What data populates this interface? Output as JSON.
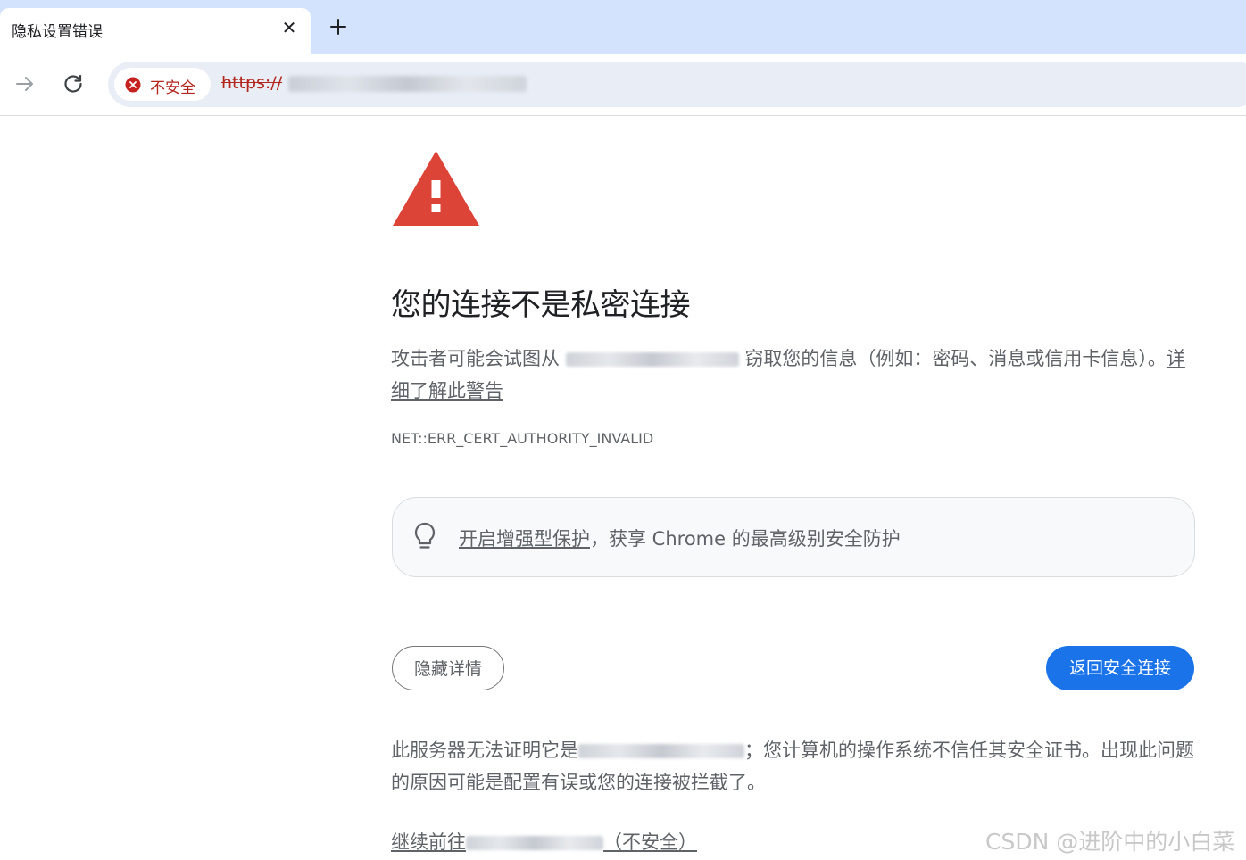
{
  "browser": {
    "tab": {
      "title": "隐私设置错误",
      "close_glyph": "✕"
    },
    "new_tab_icon": "plus-icon",
    "nav": {
      "forward_icon": "arrow-right-icon",
      "reload_icon": "reload-icon"
    },
    "omnibox": {
      "security_label": "不安全",
      "security_icon": "error-circle-icon",
      "url_prefix": "https://"
    }
  },
  "interstitial": {
    "heading": "您的连接不是私密连接",
    "description_before": "攻击者可能会试图从",
    "description_after": "窃取您的信息（例如：密码、消息或信用卡信息）。",
    "learn_more_link": "详细了解此警告",
    "error_code": "NET::ERR_CERT_AUTHORITY_INVALID",
    "promo": {
      "icon": "lightbulb-icon",
      "link_text": "开启增强型保护",
      "text": "，获享 Chrome 的最高级别安全防护"
    },
    "hide_details_button": "隐藏详情",
    "back_to_safety_button": "返回安全连接",
    "details_before": "此服务器无法证明它是",
    "details_after": "；您计算机的操作系统不信任其安全证书。出现此问题的原因可能是配置有误或您的连接被拦截了。",
    "proceed_prefix": "继续前往",
    "proceed_suffix": "（不安全）"
  },
  "watermark": "CSDN @进阶中的小白菜",
  "colors": {
    "tabstrip": "#d3e3fd",
    "omnibox": "#e9eef6",
    "danger": "#b3261e",
    "warning_triangle": "#db4437",
    "primary_button": "#1a73e8",
    "body_text": "#5f6368"
  }
}
